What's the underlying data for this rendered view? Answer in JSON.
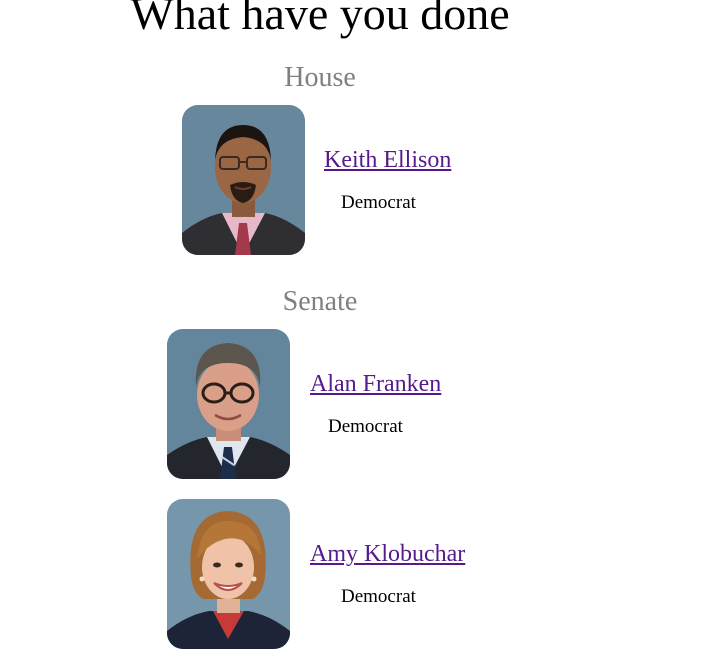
{
  "page": {
    "title": "What have you done"
  },
  "colors": {
    "link": "#551a8b",
    "section_heading": "#808080",
    "photo_background": "#6f8ea3"
  },
  "sections": [
    {
      "title": "House",
      "members": [
        {
          "name": "Keith Ellison",
          "party": "Democrat"
        }
      ]
    },
    {
      "title": "Senate",
      "members": [
        {
          "name": "Alan Franken",
          "party": "Democrat"
        },
        {
          "name": "Amy Klobuchar",
          "party": "Democrat"
        }
      ]
    }
  ]
}
